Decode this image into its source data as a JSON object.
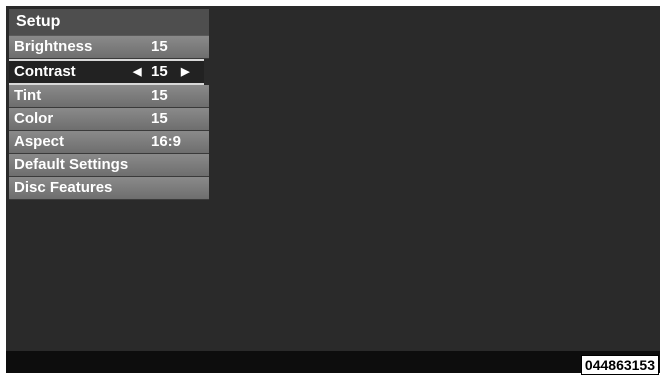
{
  "menu": {
    "title": "Setup",
    "items": [
      {
        "label": "Brightness",
        "value": "15"
      },
      {
        "label": "Contrast",
        "value": "15",
        "left_arrow": "◀",
        "right_arrow": "▶"
      },
      {
        "label": "Tint",
        "value": "15"
      },
      {
        "label": "Color",
        "value": "15"
      },
      {
        "label": "Aspect",
        "value": "16:9"
      },
      {
        "label": "Default Settings"
      },
      {
        "label": "Disc Features"
      }
    ]
  },
  "image_id": "044863153",
  "colors": {
    "screen_background": "#2a2a2a",
    "menu_item": "#7c7c7c",
    "selected_item": "#222222"
  }
}
